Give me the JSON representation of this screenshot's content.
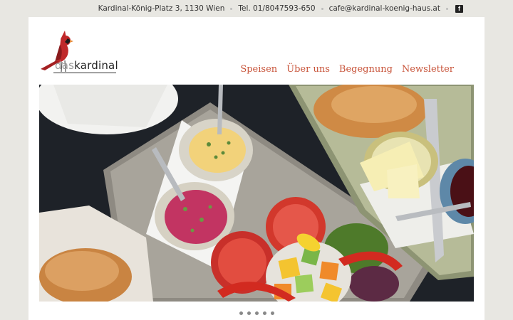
{
  "topbar": {
    "address": "Kardinal-König-Platz 3, 1130 Wien",
    "phone": "Tel. 01/8047593-650",
    "email": "cafe@kardinal-koenig-haus.at",
    "facebook_icon": "facebook-icon"
  },
  "logo": {
    "word_light": "das",
    "word_bold": "kardinal",
    "icon": "cardinal-bird-icon"
  },
  "nav": {
    "items": [
      {
        "label": "Speisen"
      },
      {
        "label": "Über uns"
      },
      {
        "label": "Begegnung"
      },
      {
        "label": "Newsletter"
      }
    ]
  },
  "hero": {
    "image": "breakfast-platter-photo"
  },
  "carousel": {
    "slide_count": 5,
    "active_index": 0
  },
  "colors": {
    "accent": "#c8543a",
    "cardinal_red": "#c0282a",
    "background": "#e8e7e2"
  }
}
